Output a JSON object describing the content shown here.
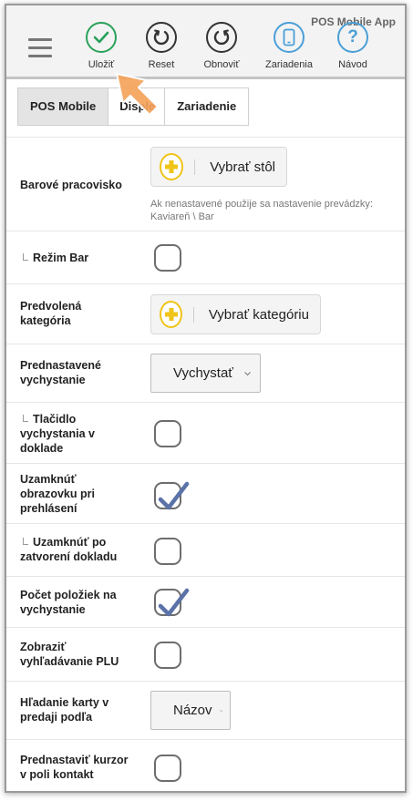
{
  "app_title": "POS Mobile App",
  "toolbar": {
    "buttons": [
      {
        "label": "Uložiť",
        "icon": "check-icon"
      },
      {
        "label": "Reset",
        "icon": "reset-icon"
      },
      {
        "label": "Obnoviť",
        "icon": "refresh-icon"
      },
      {
        "label": "Zariadenia",
        "icon": "device-icon"
      },
      {
        "label": "Návod",
        "icon": "help-icon"
      }
    ]
  },
  "tabs": [
    {
      "label": "POS Mobile",
      "active": true
    },
    {
      "label": "Disple",
      "active": false
    },
    {
      "label": "Zariadenie",
      "active": false
    }
  ],
  "rows": {
    "bar_workplace": {
      "label": "Barové pracovisko",
      "button": "Vybrať stôl",
      "hint": "Ak nenastavené použije sa nastavenie prevádzky: Kaviareň \\ Bar"
    },
    "bar_mode": {
      "label": "Režim Bar",
      "checked": false
    },
    "default_category": {
      "label": "Predvolená kategória",
      "button": "Vybrať kategóriu"
    },
    "preset_dispatch": {
      "label": "Prednastavené vychystanie",
      "value": "Vychystať"
    },
    "dispatch_button": {
      "label": "Tlačidlo vychystania v doklade",
      "checked": false
    },
    "lock_login": {
      "label": "Uzamknúť obrazovku pri prehlásení",
      "checked": true
    },
    "lock_close": {
      "label": "Uzamknúť po zatvorení dokladu",
      "checked": false
    },
    "item_count": {
      "label": "Počet položiek na vychystanie",
      "checked": true
    },
    "plu_search": {
      "label": "Zobraziť vyhľadávanie PLU",
      "checked": false
    },
    "card_search": {
      "label": "Hľadanie karty v predaji podľa",
      "value": "Názov"
    },
    "cursor_contact": {
      "label": "Prednastaviť kurzor v poli kontakt",
      "checked": false
    }
  },
  "colors": {
    "accent_green": "#2aa15a",
    "accent_blue": "#4a9fd8",
    "dark_icon": "#333333",
    "picker_yellow": "#f0c419",
    "check_blue": "#5b72a8",
    "pointer_orange": "#f5a35c"
  }
}
